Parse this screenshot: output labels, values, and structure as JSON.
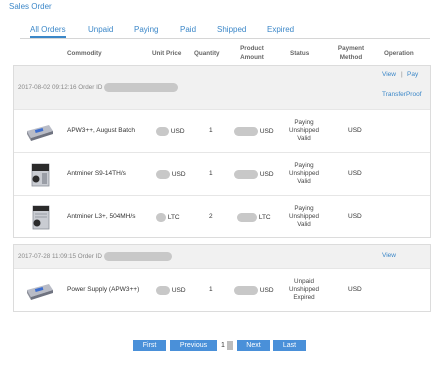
{
  "page": {
    "title": "Sales Order"
  },
  "tabs": [
    "All Orders",
    "Unpaid",
    "Paying",
    "Paid",
    "Shipped",
    "Expired"
  ],
  "table_headers": {
    "commodity": "Commodity",
    "unit_price": "Unit Price",
    "quantity": "Quantity",
    "product_amount_1": "Product",
    "product_amount_2": "Amount",
    "status": "Status",
    "payment_1": "Payment",
    "payment_2": "Method",
    "operation": "Operation"
  },
  "orders": [
    {
      "datetime": "2017-08-02 09:12:16",
      "id_label": "Order ID",
      "actions": {
        "view": "View",
        "pay": "Pay",
        "separator": "|",
        "transfer": "TransferProof"
      },
      "items": [
        {
          "name": "APW3++, August Batch",
          "currency": "USD",
          "quantity": "1",
          "amount_currency": "USD",
          "status": [
            "Paying",
            "Unshipped",
            "Valid"
          ],
          "payment": "USD",
          "icon": "power-supply-icon"
        },
        {
          "name": "Antminer S9-14TH/s",
          "currency": "USD",
          "quantity": "1",
          "amount_currency": "USD",
          "status": [
            "Paying",
            "Unshipped",
            "Valid"
          ],
          "payment": "USD",
          "icon": "miner-icon"
        },
        {
          "name": "Antminer L3+, 504MH/s",
          "currency": "LTC",
          "quantity": "2",
          "amount_currency": "LTC",
          "status": [
            "Paying",
            "Unshipped",
            "Valid"
          ],
          "payment": "USD",
          "icon": "miner-icon"
        }
      ]
    },
    {
      "datetime": "2017-07-28 11:09:15",
      "id_label": "Order ID",
      "actions": {
        "view": "View"
      },
      "items": [
        {
          "name": "Power Supply (APW3++)",
          "currency": "USD",
          "quantity": "1",
          "amount_currency": "USD",
          "status": [
            "Unpaid",
            "Unshipped",
            "Expired"
          ],
          "payment": "USD",
          "icon": "power-supply-icon"
        }
      ]
    }
  ],
  "pagination": {
    "first": "First",
    "previous": "Previous",
    "current": "1",
    "next": "Next",
    "last": "Last"
  }
}
